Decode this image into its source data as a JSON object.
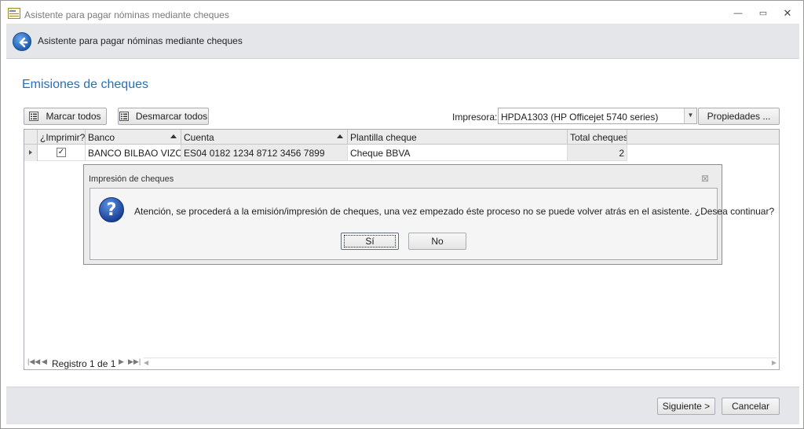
{
  "window": {
    "title": "Asistente para pagar nóminas mediante cheques",
    "controls": {
      "minimize": "—",
      "maximize": "▭",
      "close": "✕"
    }
  },
  "header": {
    "title": "Asistente para pagar nóminas mediante cheques"
  },
  "section": {
    "title": "Emisiones de cheques"
  },
  "toolbar": {
    "marcar_label": "Marcar todos",
    "desmarcar_label": "Desmarcar todos",
    "impresora_label": "Impresora:",
    "impresora_value": "HPDA1303 (HP Officejet 5740 series)",
    "propiedades_label": "Propiedades ..."
  },
  "grid": {
    "columns": [
      "¿Imprimir?",
      "Banco",
      "Cuenta",
      "Plantilla cheque",
      "Total cheques"
    ],
    "rows": [
      {
        "imprimir": true,
        "banco": "BANCO BILBAO VIZC...",
        "cuenta": "ES04 0182 1234 8712 3456 7899",
        "plantilla": "Cheque BBVA",
        "total": "2"
      }
    ],
    "footer": {
      "record_label": "Registro 1 de 1"
    }
  },
  "dialog": {
    "title": "Impresión de cheques",
    "message": "Atención, se procederá a la emisión/impresión de cheques, una vez empezado éste proceso no se puede volver atrás en el asistente. ¿Desea continuar?",
    "yes_label": "Sí",
    "no_label": "No",
    "close_glyph": "⊠"
  },
  "footer": {
    "next_label": "Siguiente >",
    "cancel_label": "Cancelar"
  },
  "colors": {
    "accent": "#2a6fb5",
    "header_bg": "#e4e6ea",
    "icon_blue": "#1e5fb2"
  }
}
